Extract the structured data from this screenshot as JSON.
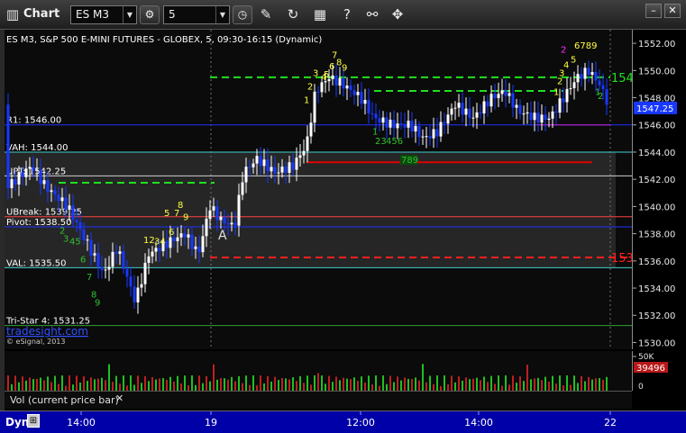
{
  "toolbar": {
    "app_title": "Chart",
    "symbol": "ES M3",
    "interval": "5",
    "icons": [
      "chart-icon",
      "settings-icon",
      "clock-icon",
      "pencil-icon",
      "refresh-icon",
      "study-icon",
      "help-icon",
      "link-icon",
      "minimize-icon",
      "close-icon"
    ]
  },
  "chart": {
    "header": "ES M3, S&P 500 E-MINI FUTURES - GLOBEX, 5, 09:30-16:15 (Dynamic)",
    "copyright": "© eSignal, 2013",
    "watermark": "tradesight.com",
    "y_range": [
      1529.5,
      1553.0
    ],
    "price_ticks": [
      "1552.00",
      "1550.00",
      "1548.00",
      "1546.00",
      "1544.00",
      "1542.00",
      "1540.00",
      "1538.00",
      "1536.00",
      "1534.00",
      "1532.00",
      "1530.00"
    ],
    "price_tick_values": [
      1552,
      1550,
      1548,
      1546,
      1544,
      1542,
      1540,
      1538,
      1536,
      1534,
      1532,
      1530
    ],
    "current_price": "1547.25",
    "current_price_value": 1547.25,
    "levels": [
      {
        "label": "R1: 1546.00",
        "value": 1546.0,
        "color": "#2030ff"
      },
      {
        "label": "VAH: 1544.00",
        "value": 1544.0,
        "color": "#40d0d0"
      },
      {
        "label": "UPT: 1542.25",
        "value": 1542.25,
        "color": "#d0d0d0"
      },
      {
        "label": "UBreak: 1539.25",
        "value": 1539.25,
        "color": "#ff4040"
      },
      {
        "label": "Pivot: 1538.50",
        "value": 1538.5,
        "color": "#2030ff"
      },
      {
        "label": "VAL: 1535.50",
        "value": 1535.5,
        "color": "#40d0d0"
      },
      {
        "label": "Tri-Star 4: 1531.25",
        "value": 1531.25,
        "color": "#30a030"
      }
    ],
    "dashed_lines": [
      {
        "value": 1549.5,
        "color": "#20e020",
        "label": "154"
      },
      {
        "value": 1536.25,
        "color": "#ff2020",
        "label": "153"
      }
    ],
    "marker_text": "A",
    "setup_counts": [
      {
        "text": "2",
        "color": "#ff30ff"
      },
      {
        "text": "3",
        "color": "#ff30ff"
      },
      {
        "text": "6789",
        "color": "#ffff40"
      },
      {
        "text": "5",
        "color": "#ffff40"
      },
      {
        "text": "4",
        "color": "#ffff40"
      },
      {
        "text": "3",
        "color": "#ffff40"
      },
      {
        "text": "2",
        "color": "#ffff40"
      },
      {
        "text": "1",
        "color": "#ffff40"
      },
      {
        "text": "7",
        "color": "#ffff40"
      },
      {
        "text": "6",
        "color": "#ffff40"
      },
      {
        "text": "8",
        "color": "#ffff40"
      },
      {
        "text": "9",
        "color": "#ffff40"
      },
      {
        "text": "4",
        "color": "#ffff40"
      },
      {
        "text": "5",
        "color": "#ffff40"
      },
      {
        "text": "3",
        "color": "#ffff40"
      },
      {
        "text": "2",
        "color": "#ffff40"
      },
      {
        "text": "1",
        "color": "#ffff40"
      },
      {
        "text": "23",
        "color": "#30c030"
      },
      {
        "text": "456",
        "color": "#30c030"
      },
      {
        "text": "1",
        "color": "#30c030"
      },
      {
        "text": "789",
        "color": "#30c030"
      },
      {
        "text": "8",
        "color": "#ffff40"
      },
      {
        "text": "5",
        "color": "#ffff40"
      },
      {
        "text": "7",
        "color": "#ffff40"
      },
      {
        "text": "9",
        "color": "#ffff40"
      },
      {
        "text": "6",
        "color": "#ffff40"
      },
      {
        "text": "12",
        "color": "#ffff40"
      },
      {
        "text": "34",
        "color": "#ffff40"
      },
      {
        "text": "2",
        "color": "#30c030"
      },
      {
        "text": "3",
        "color": "#30c030"
      },
      {
        "text": "45",
        "color": "#30c030"
      },
      {
        "text": "6",
        "color": "#30c030"
      },
      {
        "text": "7",
        "color": "#30c030"
      },
      {
        "text": "8",
        "color": "#30c030"
      },
      {
        "text": "9",
        "color": "#30c030"
      },
      {
        "text": "1",
        "color": "#30c030"
      },
      {
        "text": "2",
        "color": "#30c030"
      }
    ]
  },
  "volume": {
    "current_value": "39496",
    "ticks": [
      "50K",
      "0"
    ],
    "status_label": "Vol (current price bar)"
  },
  "time_axis": {
    "label": "Dyn",
    "ticks": [
      "14:00",
      "19",
      "12:00",
      "14:00",
      "22"
    ]
  },
  "colors": {
    "up_bar": "#ffffff",
    "down_bar": "#1838ff",
    "axis_bg": "#0000a8",
    "accent_green": "#20e020",
    "accent_red": "#ff2020"
  }
}
